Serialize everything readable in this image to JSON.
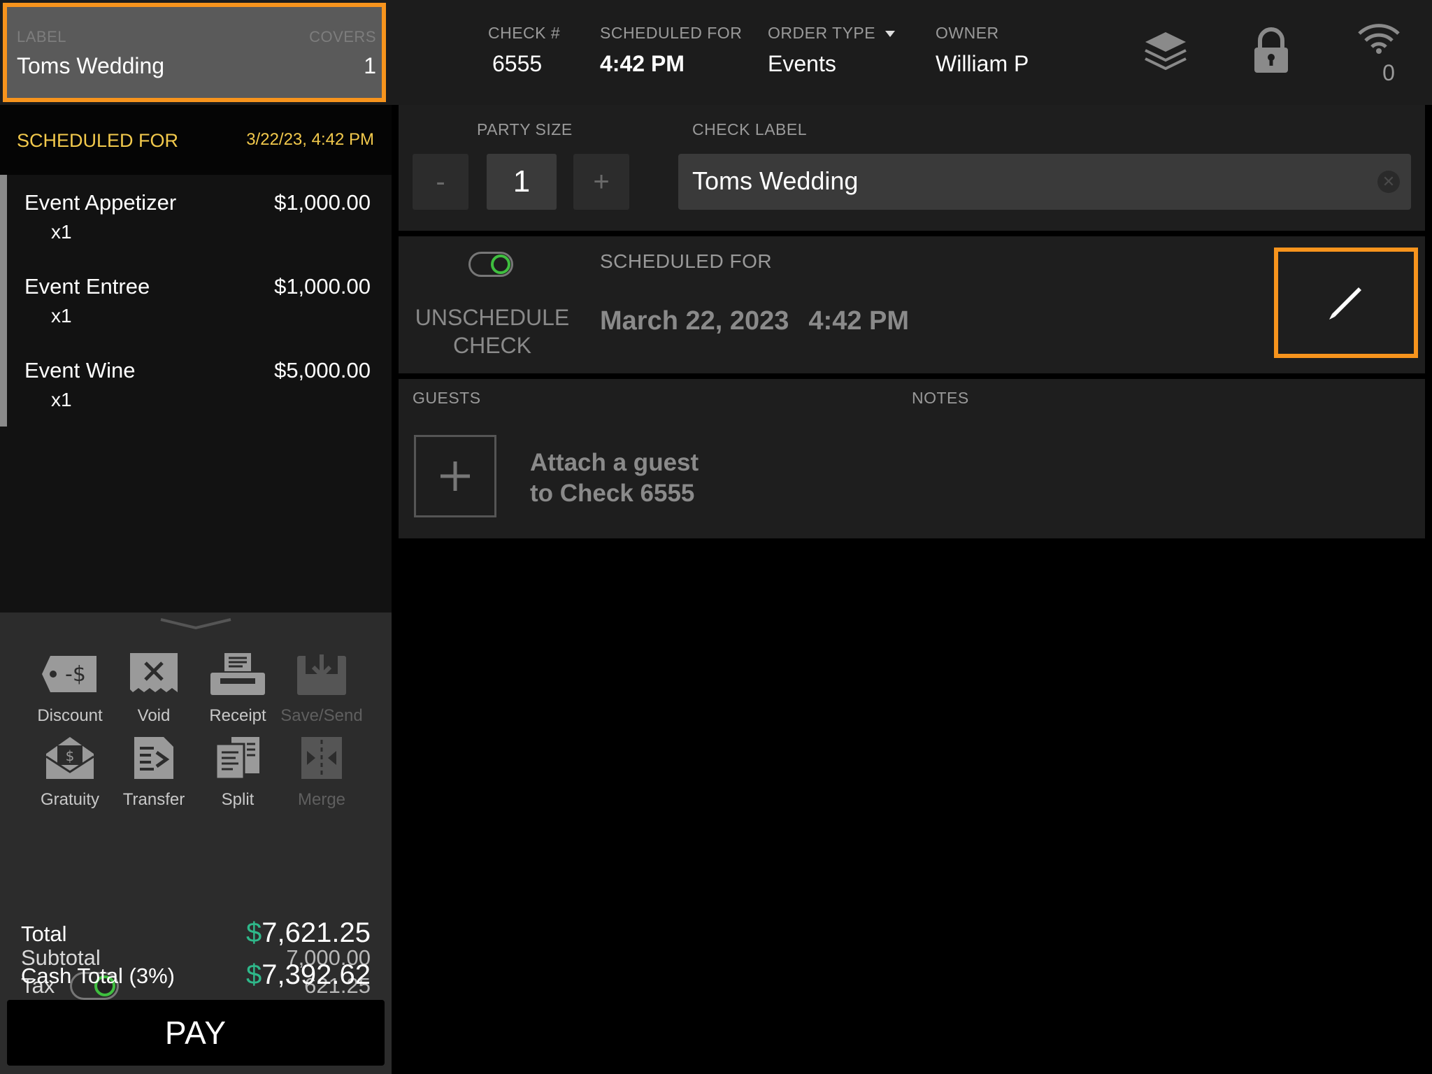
{
  "header": {
    "label_caption": "LABEL",
    "label_value": "Toms Wedding",
    "covers_caption": "COVERS",
    "covers_value": "1",
    "check_caption": "CHECK #",
    "check_value": "6555",
    "scheduled_caption": "SCHEDULED FOR",
    "scheduled_value": "4:42 PM",
    "order_type_caption": "ORDER TYPE",
    "order_type_value": "Events",
    "owner_caption": "OWNER",
    "owner_value": "William P",
    "icons": [
      "layers-icon",
      "lock-icon",
      "wifi-icon"
    ],
    "wifi_count": "0"
  },
  "sidebar": {
    "scheduled_title": "SCHEDULED FOR",
    "scheduled_date": "3/22/23, 4:42 PM",
    "items": [
      {
        "name": "Event Appetizer",
        "price": "$1,000.00",
        "qty": "x1"
      },
      {
        "name": "Event Entree",
        "price": "$1,000.00",
        "qty": "x1"
      },
      {
        "name": "Event Wine",
        "price": "$5,000.00",
        "qty": "x1"
      }
    ],
    "actions": [
      {
        "label": "Discount",
        "icon": "discount-tag-icon"
      },
      {
        "label": "Void",
        "icon": "void-receipt-icon"
      },
      {
        "label": "Receipt",
        "icon": "printer-icon"
      },
      {
        "label": "Save/Send",
        "icon": "save-send-icon"
      },
      {
        "label": "Gratuity",
        "icon": "gratuity-envelope-icon"
      },
      {
        "label": "Transfer",
        "icon": "transfer-icon"
      },
      {
        "label": "Split",
        "icon": "split-icon"
      },
      {
        "label": "Merge",
        "icon": "merge-icon"
      }
    ],
    "subtotal_label": "Subtotal",
    "subtotal_value": "7,000.00",
    "tax_label": "Tax",
    "tax_value": "621.25",
    "total_label": "Total",
    "total_currency": "$",
    "total_value": "7,621.25",
    "cash_total_label": "Cash Total (3%)",
    "cash_total_currency": "$",
    "cash_total_value": "7,392.62",
    "pay_label": "PAY"
  },
  "main": {
    "party_size_caption": "PARTY SIZE",
    "party_minus": "-",
    "party_size_value": "1",
    "party_plus": "+",
    "check_label_caption": "CHECK LABEL",
    "check_label_value": "Toms Wedding",
    "unschedule_line1": "UNSCHEDULE",
    "unschedule_line2": "CHECK",
    "scheduled_caption": "SCHEDULED FOR",
    "scheduled_date": "March 22, 2023",
    "scheduled_time": "4:42 PM",
    "guests_caption": "GUESTS",
    "notes_caption": "NOTES",
    "attach_line1": "Attach a guest",
    "attach_line2": "to Check 6555"
  },
  "colors": {
    "highlight": "#f7941d",
    "accent_yellow": "#f2c94c",
    "toggle_green": "#3fbf3f",
    "currency_green": "#2fb88a"
  }
}
